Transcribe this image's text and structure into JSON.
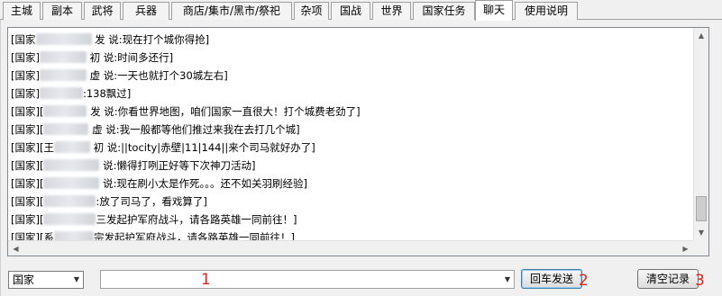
{
  "tabs": [
    {
      "label": "主城",
      "active": false
    },
    {
      "label": "副本",
      "active": false
    },
    {
      "label": "武将",
      "active": false
    },
    {
      "label": "兵器",
      "active": false
    },
    {
      "label": "商店/集市/黑市/祭祀",
      "active": false
    },
    {
      "label": "杂项",
      "active": false
    },
    {
      "label": "国战",
      "active": false
    },
    {
      "label": "世界",
      "active": false
    },
    {
      "label": "国家任务",
      "active": false
    },
    {
      "label": "聊天",
      "active": true
    },
    {
      "label": "使用说明",
      "active": false
    }
  ],
  "chat": {
    "lines": [
      {
        "prefix": "[国家",
        "tail": "发 说:现在打个城你得抢]"
      },
      {
        "prefix": "[国家]",
        "tail": "初 说:时间多还行]"
      },
      {
        "prefix": "[国家]",
        "tail": "虚 说:一天也就打个30城左右]"
      },
      {
        "prefix": "[国家]",
        "tail": ":138飘过]"
      },
      {
        "prefix": "[国家][",
        "tail": "发 说:你看世界地图，咱们国家一直很大！打个城费老劲了]"
      },
      {
        "prefix": "[国家][",
        "tail": "虚 说:我一般都等他们推过来我在去打几个城]"
      },
      {
        "prefix": "[国家][王",
        "tail": "初 说:||tocity|赤壁|11|144||来个司马就好办了]"
      },
      {
        "prefix": "[国家][",
        "tail": "说:懒得打咧正好等下次神刀活动]"
      },
      {
        "prefix": "[国家][",
        "tail": "说:现在刷小太是作死。。。还不如关羽刷经验]"
      },
      {
        "prefix": "[国家][",
        "tail": ":放了司马了，看戏算了]"
      },
      {
        "prefix": "[国家][",
        "tail": "三发起护军府战斗，请各路英雄一同前往！]"
      },
      {
        "prefix": "[国家][系",
        "tail": "宗发起护军府战斗，请各路英雄一同前往！]"
      }
    ]
  },
  "controls": {
    "channel_select": "国家",
    "message_input": "",
    "send_button": "回车发送",
    "clear_button": "清空记录"
  },
  "annotations": {
    "one": "1",
    "two": "2",
    "three": "3"
  },
  "colors": {
    "annotation": "#e0251b",
    "focus_border": "#3c7fb1"
  }
}
